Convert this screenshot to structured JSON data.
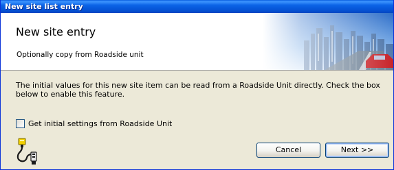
{
  "window": {
    "title": "New site list entry"
  },
  "header": {
    "title": "New site entry",
    "subtitle": "Optionally copy from Roadside unit"
  },
  "content": {
    "description": "The initial values for this new site item can be read from a Roadside Unit directly. Check the box below to enable this feature.",
    "checkbox_label": "Get initial settings from Roadside Unit",
    "checkbox_checked": false
  },
  "buttons": {
    "cancel_label": "Cancel",
    "next_label": "Next >>"
  },
  "icons": {
    "connector": "cable-connector-icon",
    "header_art": "city-road-banner"
  },
  "colors": {
    "titlebar": "#0554d6",
    "dialog_bg": "#ece9d8",
    "header_bg": "#ffffff"
  }
}
